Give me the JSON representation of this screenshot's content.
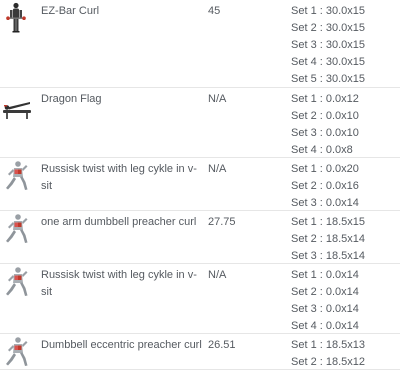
{
  "exercises": [
    {
      "icon": "ez-bar-curl-figure-icon",
      "name": "EZ-Bar Curl",
      "weight": "45",
      "sets": [
        "Set 1 : 30.0x15",
        "Set 2 : 30.0x15",
        "Set 3 : 30.0x15",
        "Set 4 : 30.0x15",
        "Set 5 : 30.0x15"
      ]
    },
    {
      "icon": "dragon-flag-bench-icon",
      "name": "Dragon Flag",
      "weight": "N/A",
      "sets": [
        "Set 1 : 0.0x12",
        "Set 2 : 0.0x10",
        "Set 3 : 0.0x10",
        "Set 4 : 0.0x8"
      ]
    },
    {
      "icon": "anatomy-figure-icon",
      "name": "Russisk twist with leg cykle in v-sit",
      "weight": "N/A",
      "sets": [
        "Set 1 : 0.0x20",
        "Set 2 : 0.0x16",
        "Set 3 : 0.0x14"
      ]
    },
    {
      "icon": "anatomy-figure-icon",
      "name": "one arm dumbbell preacher curl",
      "weight": "27.75",
      "sets": [
        "Set 1 : 18.5x15",
        "Set 2 : 18.5x14",
        "Set 3 : 18.5x14"
      ]
    },
    {
      "icon": "anatomy-figure-icon",
      "name": "Russisk twist with leg cykle in v-sit",
      "weight": "N/A",
      "sets": [
        "Set 1 : 0.0x14",
        "Set 2 : 0.0x14",
        "Set 3 : 0.0x14",
        "Set 4 : 0.0x14"
      ]
    },
    {
      "icon": "anatomy-figure-icon",
      "name": "Dumbbell eccentric preacher curl",
      "weight": "26.51",
      "sets": [
        "Set 1 : 18.5x13",
        "Set 2 : 18.5x12"
      ]
    }
  ]
}
